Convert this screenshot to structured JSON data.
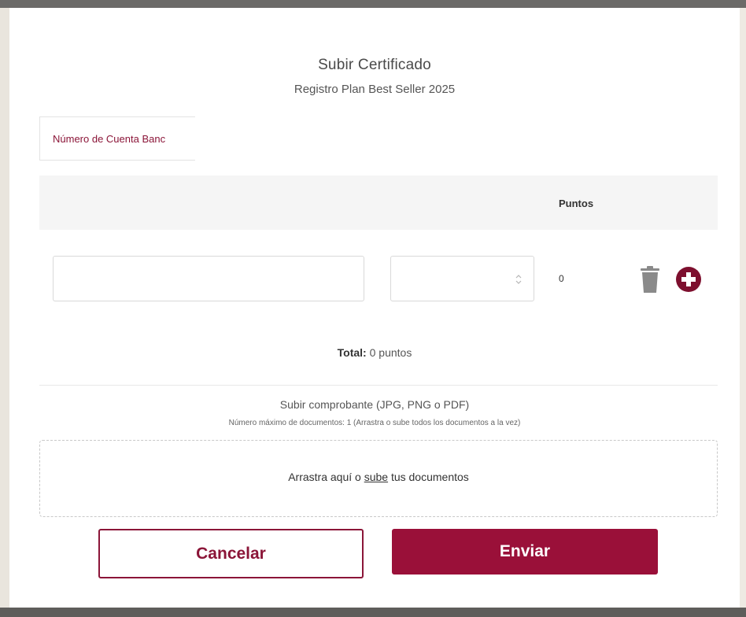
{
  "modal": {
    "title": "Subir Certificado",
    "subtitle": "Registro Plan Best Seller 2025"
  },
  "account_field": {
    "label": "Número de Cuenta Banc"
  },
  "table": {
    "header": {
      "points_label": "Puntos"
    },
    "rows": [
      {
        "field1_value": "",
        "field2_value": "",
        "points": "0",
        "delete_icon": "trash-icon",
        "add_icon": "plus-circle-icon"
      }
    ]
  },
  "total": {
    "label": "Total:",
    "value": " 0 puntos"
  },
  "upload": {
    "title": "Subir comprobante (JPG, PNG o PDF)",
    "hint": "Número máximo de documentos: 1 (Arrastra o sube todos los documentos a la vez)",
    "dropzone_prefix": "Arrastra aquí o ",
    "dropzone_link": "sube",
    "dropzone_suffix": " tus documentos"
  },
  "buttons": {
    "cancel": "Cancelar",
    "send": "Enviar"
  },
  "colors": {
    "brand": "#9a1039",
    "brand_text": "#8b1538",
    "icon_gray": "#8a8a8a"
  }
}
